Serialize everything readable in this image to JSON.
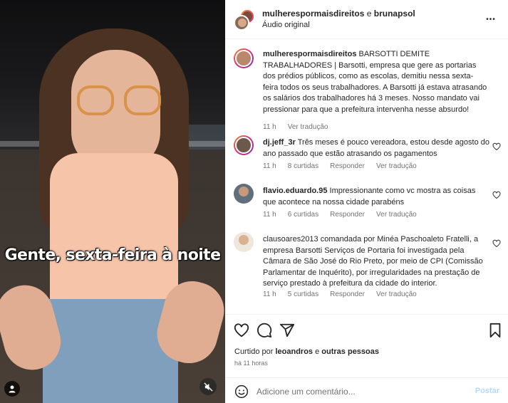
{
  "video": {
    "caption": "Gente, sexta-feira à noite"
  },
  "header": {
    "author_primary": "mulherespormaisdireitos",
    "connector": " e ",
    "author_secondary": "brunapsol",
    "subtitle": "Áudio original",
    "more_label": "•••"
  },
  "post": {
    "username": "mulherespormaisdireitos",
    "text": "BARSOTTI DEMITE TRABALHADORES | Barsotti, empresa que gere as portarias dos prédios públicos, como as escolas, demitiu nessa sexta-feira todos os seus trabalhadores. A Barsotti já estava atrasando os salários dos trabalhadores há 3 meses. Nosso mandato vai pressionar para que a prefeitura intervenha nesse absurdo!",
    "time": "11 h",
    "translate": "Ver tradução"
  },
  "comments": [
    {
      "username": "dj.jeff_3r",
      "text": "Três meses é pouco vereadora, estou desde agosto do ano passado que estão atrasando os pagamentos",
      "time": "11 h",
      "likes": "8 curtidas",
      "reply": "Responder",
      "translate": "Ver tradução"
    },
    {
      "username": "flavio.eduardo.95",
      "text": "Impressionante como vc mostra as coisas que acontece na nossa cidade parabéns",
      "time": "11 h",
      "likes": "6 curtidas",
      "reply": "Responder",
      "translate": "Ver tradução"
    },
    {
      "username": "clausoares2013",
      "text": "comandada por Minéa Paschoaleto Fratelli, a empresa Barsotti Serviços de Portaria foi investigada pela Câmara de São José do Rio Preto, por meio de CPI (Comissão Parlamentar de Inquérito), por irregularidades na prestação de serviço prestado à prefeitura da cidade do interior.",
      "time": "11 h",
      "likes": "5 curtidas",
      "reply": "Responder",
      "translate": "Ver tradução"
    }
  ],
  "footer": {
    "liked_prefix": "Curtido por ",
    "liked_user": "leoandros",
    "liked_suffix": " e ",
    "liked_others": "outras pessoas",
    "time": "há 11 horas",
    "comment_placeholder": "Adicione um comentário...",
    "post_label": "Postar"
  },
  "colors": {
    "text": "#262626",
    "secondary": "#737373",
    "post_disabled": "#b3dbff",
    "border": "#efefef"
  }
}
